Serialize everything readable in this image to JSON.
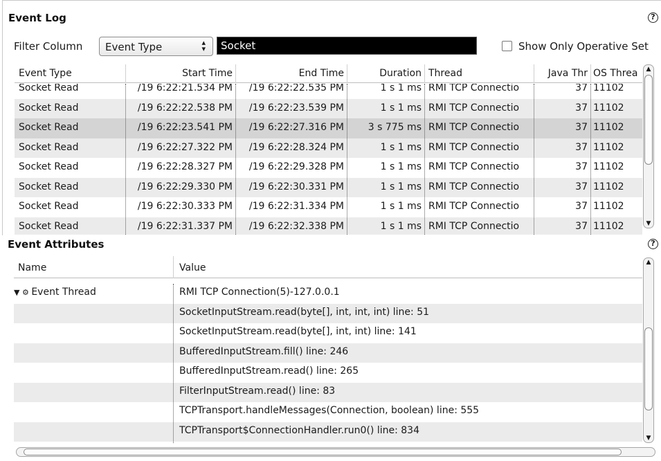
{
  "event_log": {
    "title": "Event Log",
    "help": "?",
    "filter_label": "Filter Column",
    "filter_column": "Event Type",
    "filter_text": "Socket",
    "show_operative_label": "Show Only Operative Set",
    "columns": [
      "Event Type",
      "Start Time",
      "End Time",
      "Duration",
      "Thread",
      "Java Thr",
      "OS Threa"
    ],
    "rows": [
      {
        "event_type": "Socket Read",
        "start": "/19 6:22:21.534 PM",
        "end": "/19 6:22:22.535 PM",
        "duration": "1 s 1 ms",
        "thread": "RMI TCP Connectio",
        "java_thr": "37",
        "os_thr": "11102"
      },
      {
        "event_type": "Socket Read",
        "start": "/19 6:22:22.538 PM",
        "end": "/19 6:22:23.539 PM",
        "duration": "1 s 1 ms",
        "thread": "RMI TCP Connectio",
        "java_thr": "37",
        "os_thr": "11102"
      },
      {
        "event_type": "Socket Read",
        "start": "/19 6:22:23.541 PM",
        "end": "/19 6:22:27.316 PM",
        "duration": "3 s 775 ms",
        "thread": "RMI TCP Connectio",
        "java_thr": "37",
        "os_thr": "11102"
      },
      {
        "event_type": "Socket Read",
        "start": "/19 6:22:27.322 PM",
        "end": "/19 6:22:28.324 PM",
        "duration": "1 s 1 ms",
        "thread": "RMI TCP Connectio",
        "java_thr": "37",
        "os_thr": "11102"
      },
      {
        "event_type": "Socket Read",
        "start": "/19 6:22:28.327 PM",
        "end": "/19 6:22:29.328 PM",
        "duration": "1 s 1 ms",
        "thread": "RMI TCP Connectio",
        "java_thr": "37",
        "os_thr": "11102"
      },
      {
        "event_type": "Socket Read",
        "start": "/19 6:22:29.330 PM",
        "end": "/19 6:22:30.331 PM",
        "duration": "1 s 1 ms",
        "thread": "RMI TCP Connectio",
        "java_thr": "37",
        "os_thr": "11102"
      },
      {
        "event_type": "Socket Read",
        "start": "/19 6:22:30.333 PM",
        "end": "/19 6:22:31.334 PM",
        "duration": "1 s 1 ms",
        "thread": "RMI TCP Connectio",
        "java_thr": "37",
        "os_thr": "11102"
      },
      {
        "event_type": "Socket Read",
        "start": "/19 6:22:31.337 PM",
        "end": "/19 6:22:32.338 PM",
        "duration": "1 s 1 ms",
        "thread": "RMI TCP Connectio",
        "java_thr": "37",
        "os_thr": "11102"
      }
    ]
  },
  "event_attributes": {
    "title": "Event Attributes",
    "help": "?",
    "columns": [
      "Name",
      "Value"
    ],
    "rows": [
      {
        "name": "Event Thread",
        "value": "RMI TCP Connection(5)-127.0.0.1",
        "type": "thread"
      },
      {
        "name": "",
        "value": "SocketInputStream.read(byte[], int, int, int) line: 51",
        "type": "frame"
      },
      {
        "name": "",
        "value": "SocketInputStream.read(byte[], int, int) line: 141",
        "type": "frame"
      },
      {
        "name": "",
        "value": "BufferedInputStream.fill() line: 246",
        "type": "frame"
      },
      {
        "name": "",
        "value": "BufferedInputStream.read() line: 265",
        "type": "frame"
      },
      {
        "name": "",
        "value": "FilterInputStream.read() line: 83",
        "type": "frame"
      },
      {
        "name": "",
        "value": "TCPTransport.handleMessages(Connection, boolean) line: 555",
        "type": "frame"
      },
      {
        "name": "",
        "value": "TCPTransport$ConnectionHandler.run0() line: 834",
        "type": "frame"
      }
    ]
  },
  "icons": {
    "help": "help-circle-icon",
    "select_arrows": "up-down-arrows-icon",
    "expand": "triangle-down-icon",
    "thread": "thread-gear-icon",
    "stack_frame": "stack-frame-icon"
  },
  "colors": {
    "filter_input_bg": "#000000",
    "selected_row": "#d4d4d4",
    "alt_row": "#ebebeb"
  }
}
